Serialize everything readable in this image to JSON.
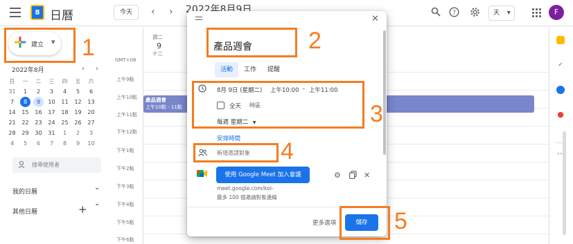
{
  "header": {
    "app_title": "日曆",
    "logo_day": "8",
    "today_label": "今天",
    "prev_label": "‹",
    "next_label": "›",
    "date_title": "2022年8月9日",
    "view_label": "天",
    "avatar_letter": "F"
  },
  "sidebar": {
    "create_label": "建立",
    "month_label": "2022年8月",
    "weekdays": [
      "日",
      "一",
      "二",
      "三",
      "四",
      "五",
      "六"
    ],
    "weeks": [
      [
        "31",
        "1",
        "2",
        "3",
        "4",
        "5",
        "6"
      ],
      [
        "7",
        "8",
        "9",
        "10",
        "11",
        "12",
        "13"
      ],
      [
        "14",
        "15",
        "16",
        "17",
        "18",
        "19",
        "20"
      ],
      [
        "21",
        "22",
        "23",
        "24",
        "25",
        "26",
        "27"
      ],
      [
        "28",
        "29",
        "30",
        "31",
        "1",
        "2",
        "3"
      ],
      [
        "4",
        "5",
        "6",
        "7",
        "8",
        "9",
        "10"
      ]
    ],
    "search_placeholder": "搜尋使用者",
    "my_calendars": "我的日曆",
    "other_calendars": "其他日曆"
  },
  "calendar": {
    "day_of_week": "週二",
    "day_number": "9",
    "lunar_day": "十二",
    "timezone": "GMT+08",
    "time_labels": [
      "上午9點",
      "上午10點",
      "上午11點",
      "下午12點",
      "下午1點",
      "下午2點",
      "下午3點",
      "下午4點",
      "下午5點",
      "下午6點"
    ],
    "event_title": "產品週會",
    "event_time": "上午10點 - 11點"
  },
  "dialog": {
    "title_value": "產品週會",
    "tabs": [
      "活動",
      "工作",
      "提醒"
    ],
    "date": "8月 9日 (星期二)",
    "start_time": "上午10:00",
    "dash": "–",
    "end_time": "上午11:00",
    "all_day": "全天",
    "timezone": "時區",
    "repeat": "每週 星期二",
    "find_time": "安排時間",
    "guest_placeholder": "新增邀請對象",
    "meet_button": "使用 Google Meet 加入會議",
    "meet_link": "meet.google.com/koi-",
    "meet_capacity": "最多 100 個邀請對象連線",
    "more_options": "更多選項",
    "save": "儲存"
  },
  "annotations": [
    "1",
    "2",
    "3",
    "4",
    "5"
  ],
  "colors": {
    "accent": "#1a73e8",
    "event": "#7986cb",
    "annotation": "#f57c1f"
  }
}
